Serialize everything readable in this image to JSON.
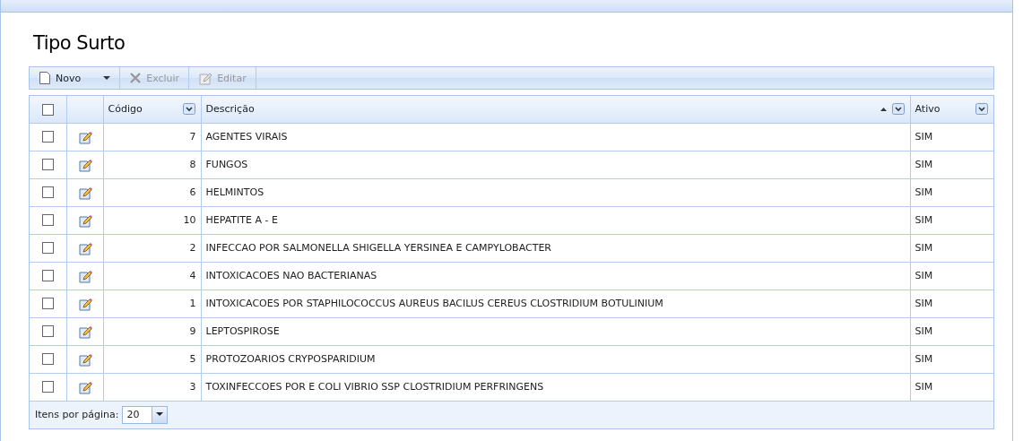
{
  "page": {
    "title": "Tipo Surto"
  },
  "toolbar": [
    {
      "label": "Novo",
      "kind": "new",
      "disabled": false,
      "dropdown": true
    },
    {
      "label": "Excluir",
      "kind": "delete",
      "disabled": true,
      "dropdown": false
    },
    {
      "label": "Editar",
      "kind": "edit",
      "disabled": true,
      "dropdown": false
    }
  ],
  "table": {
    "select_all_checked": false,
    "columns": [
      {
        "label": "Código",
        "sorted_ascending": false
      },
      {
        "label": "Descrição",
        "sorted_ascending": true
      },
      {
        "label": "Ativo",
        "sorted_ascending": false
      }
    ],
    "rows": [
      {
        "checked": false,
        "codigo": "7",
        "descricao": "AGENTES VIRAIS",
        "ativo": "SIM"
      },
      {
        "checked": false,
        "codigo": "8",
        "descricao": "FUNGOS",
        "ativo": "SIM"
      },
      {
        "checked": false,
        "codigo": "6",
        "descricao": "HELMINTOS",
        "ativo": "SIM"
      },
      {
        "checked": false,
        "codigo": "10",
        "descricao": "HEPATITE A - E",
        "ativo": "SIM"
      },
      {
        "checked": false,
        "codigo": "2",
        "descricao": "INFECCAO POR SALMONELLA SHIGELLA YERSINEA E CAMPYLOBACTER",
        "ativo": "SIM"
      },
      {
        "checked": false,
        "codigo": "4",
        "descricao": "INTOXICACOES NAO BACTERIANAS",
        "ativo": "SIM"
      },
      {
        "checked": false,
        "codigo": "1",
        "descricao": "INTOXICACOES POR STAPHILOCOCCUS AUREUS BACILUS CEREUS CLOSTRIDIUM BOTULINIUM",
        "ativo": "SIM"
      },
      {
        "checked": false,
        "codigo": "9",
        "descricao": "LEPTOSPIROSE",
        "ativo": "SIM"
      },
      {
        "checked": false,
        "codigo": "5",
        "descricao": "PROTOZOARIOS CRYPOSPARIDIUM",
        "ativo": "SIM"
      },
      {
        "checked": false,
        "codigo": "3",
        "descricao": "TOXINFECCOES POR E COLI VIBRIO SSP CLOSTRIDIUM PERFRINGENS",
        "ativo": "SIM"
      }
    ]
  },
  "pager": {
    "label": "Itens por página:",
    "value": "20"
  }
}
